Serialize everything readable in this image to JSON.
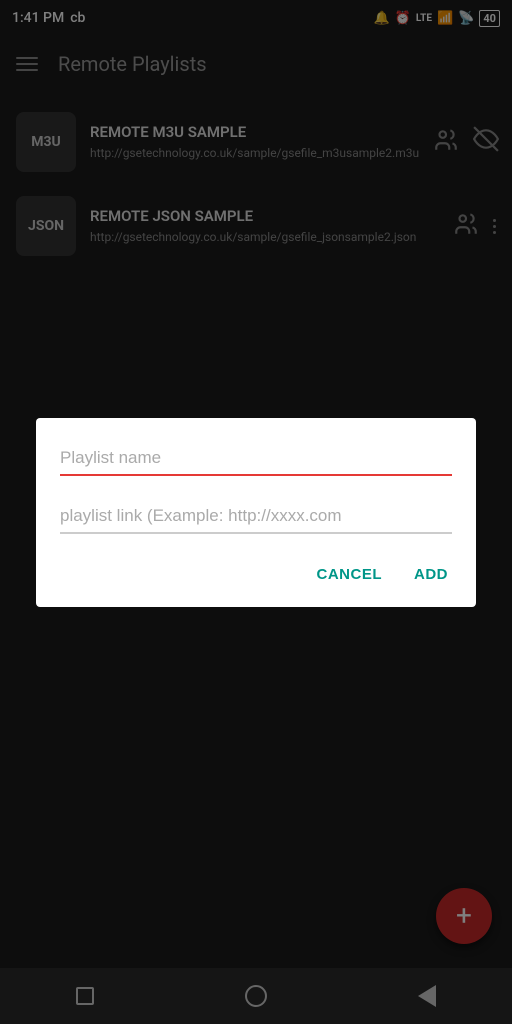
{
  "statusBar": {
    "time": "1:41 PM",
    "carrier": "cb",
    "batteryLevel": "40"
  },
  "toolbar": {
    "title": "Remote Playlists",
    "menuLabel": "menu"
  },
  "playlists": [
    {
      "id": "m3u",
      "badge": "M3U",
      "name": "REMOTE M3U SAMPLE",
      "url": "http://gsetechnology.co.uk/sample/gsefile_m3usample2.m3u",
      "hasEyeIcon": true,
      "hasPeopleIcon": true
    },
    {
      "id": "json",
      "badge": "JSON",
      "name": "REMOTE JSON SAMPLE",
      "url": "http://gsetechnology.co.uk/sample/gsefile_jsonsample2.json",
      "hasEyeIcon": false,
      "hasPeopleIcon": true
    }
  ],
  "dialog": {
    "nameField": {
      "placeholder": "Playlist name",
      "value": ""
    },
    "linkField": {
      "placeholder": "playlist link (Example: http://xxxx.com",
      "value": ""
    },
    "cancelLabel": "CANCEL",
    "addLabel": "ADD"
  },
  "fab": {
    "label": "+"
  },
  "bottomNav": {
    "items": [
      "square",
      "circle",
      "triangle"
    ]
  }
}
